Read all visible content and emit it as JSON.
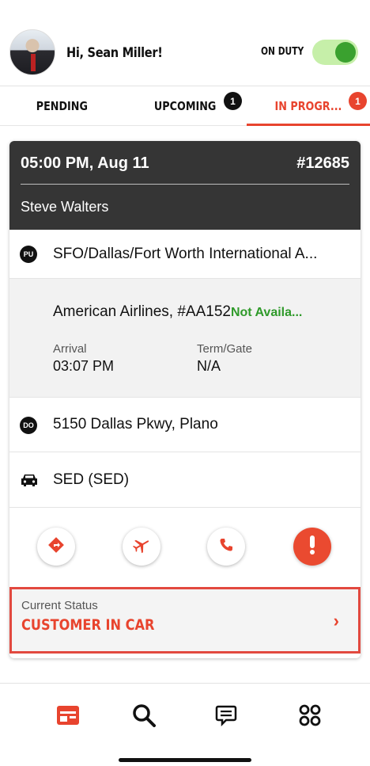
{
  "header": {
    "greeting": "Hi, Sean Miller!",
    "duty_label": "ON DUTY",
    "duty_on": true,
    "avatar_icon": "driver-avatar"
  },
  "tabs": [
    {
      "label": "PENDING",
      "badge": ""
    },
    {
      "label": "UPCOMING",
      "badge": "1"
    },
    {
      "label": "IN PROGR...",
      "badge": "1",
      "active": true
    }
  ],
  "trip": {
    "datetime": "05:00 PM, Aug 11",
    "number": "#12685",
    "passenger": "Steve Walters",
    "pickup_tag": "PU",
    "pickup": "SFO/Dallas/Fort Worth International A...",
    "flight": "American Airlines, #AA152",
    "flight_status": "Not Availa...",
    "arrival_label": "Arrival",
    "arrival_value": "03:07 PM",
    "gate_label": "Term/Gate",
    "gate_value": "N/A",
    "dropoff_tag": "DO",
    "dropoff": "5150 Dallas Pkwy, Plano",
    "vehicle": "SED (SED)",
    "actions": [
      "directions-icon",
      "flight-icon",
      "phone-icon",
      "alert-icon"
    ]
  },
  "status": {
    "label": "Current Status",
    "value": "CUSTOMER IN CAR",
    "chevron": "›"
  },
  "nav": [
    "trips-icon",
    "search-icon",
    "messages-icon",
    "apps-icon"
  ],
  "colors": {
    "accent": "#e8442e",
    "dark_header": "#353535",
    "toggle_on": "#3aa12f",
    "status_ok": "#2f9a2a"
  }
}
